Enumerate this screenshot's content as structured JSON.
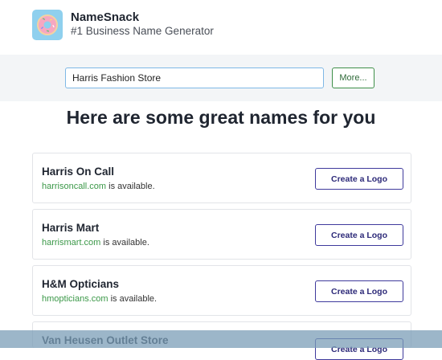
{
  "app": {
    "name": "NameSnack",
    "tagline": "#1 Business Name Generator"
  },
  "search": {
    "value": "Harris Fashion Store",
    "more_label": "More..."
  },
  "results": {
    "heading": "Here are some great names for you",
    "availability_suffix": "is available.",
    "create_logo_label": "Create a Logo",
    "items": [
      {
        "name": "Harris On Call",
        "domain": "harrisoncall.com",
        "status": "is available.",
        "button": "Create a Logo"
      },
      {
        "name": "Harris Mart",
        "domain": "harrismart.com",
        "status": "is available.",
        "button": "Create a Logo"
      },
      {
        "name": "H&M Opticians",
        "domain": "hmopticians.com",
        "status": "is available.",
        "button": "Create a Logo"
      },
      {
        "name": "Van Heusen Outlet Store",
        "domain": "",
        "status": "",
        "button": "Create a Logo"
      }
    ]
  },
  "colors": {
    "domain_green": "#3b9848",
    "button_purple": "#3f3a9c",
    "more_green": "#3e8f49",
    "input_border": "#7fb8e6",
    "logo_bg": "#8fd0ee"
  },
  "icons": {
    "logo": "donut-icon"
  }
}
